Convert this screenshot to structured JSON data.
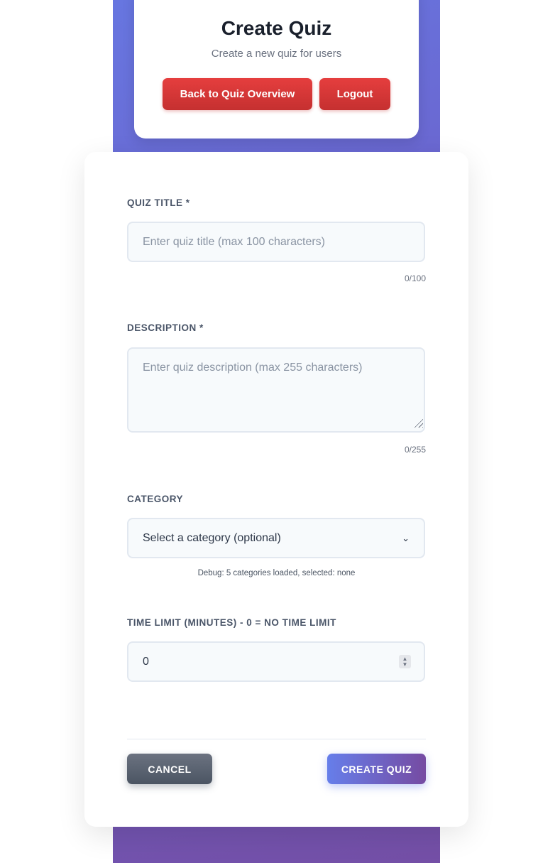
{
  "header": {
    "title": "Create Quiz",
    "subtitle": "Create a new quiz for users",
    "back_label": "Back to Quiz Overview",
    "logout_label": "Logout"
  },
  "form": {
    "title_label": "QUIZ TITLE *",
    "title_placeholder": "Enter quiz title (max 100 characters)",
    "title_value": "",
    "title_counter": "0/100",
    "description_label": "DESCRIPTION *",
    "description_placeholder": "Enter quiz description (max 255 characters)",
    "description_value": "",
    "description_counter": "0/255",
    "category_label": "CATEGORY",
    "category_selected": "Select a category (optional)",
    "debug_text": "Debug: 5 categories loaded, selected: none",
    "time_limit_label": "TIME LIMIT (MINUTES) - 0 = NO TIME LIMIT",
    "time_limit_value": "0",
    "cancel_label": "CANCEL",
    "create_label": "CREATE QUIZ"
  },
  "colors": {
    "accent_gradient_start": "#667eea",
    "accent_gradient_end": "#764ba2",
    "danger": "#e53e3e",
    "neutral_button": "#4b5563"
  }
}
